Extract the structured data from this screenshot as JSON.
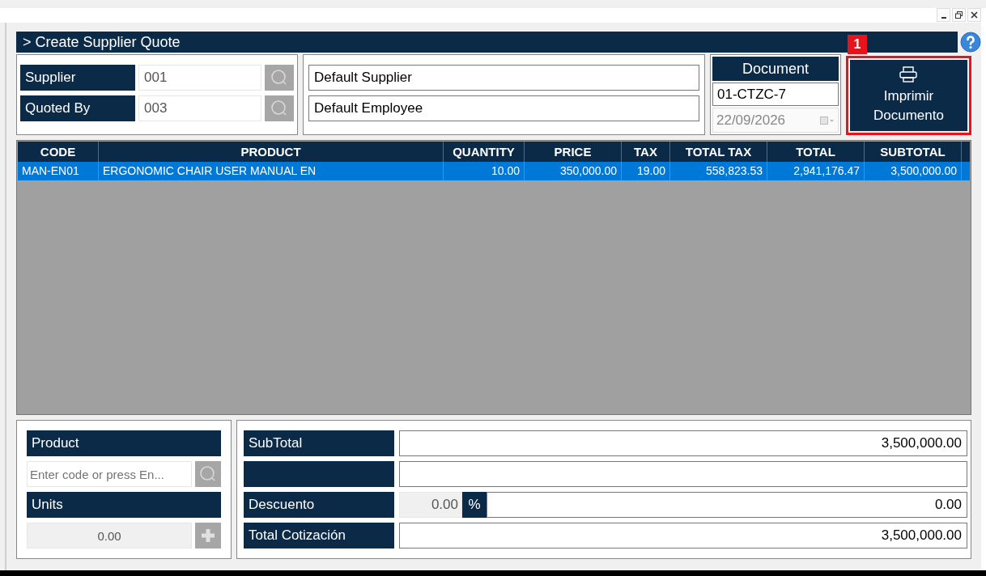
{
  "header": {
    "title": "> Create Supplier Quote"
  },
  "lookups": [
    {
      "label": "Supplier",
      "value": "001",
      "name": "Default Supplier"
    },
    {
      "label": "Quoted By",
      "value": "003",
      "name": "Default Employee"
    }
  ],
  "document": {
    "label": "Document",
    "number": "01-CTZC-7",
    "date": "22/09/2026",
    "date_disabled": true
  },
  "print_button": {
    "label": "Imprimir Documento"
  },
  "callout": {
    "label": "1"
  },
  "table": {
    "columns": [
      "CODE",
      "PRODUCT",
      "QUANTITY",
      "PRICE",
      "TAX",
      "TOTAL TAX",
      "TOTAL",
      "SUBTOTAL"
    ],
    "rows": [
      {
        "selected": true,
        "cells": [
          "MAN-EN01",
          "ERGONOMIC CHAIR USER MANUAL EN",
          "10.00",
          "350,000.00",
          "19.00",
          "558,823.53",
          "2,941,176.47",
          "3,500,000.00"
        ]
      }
    ]
  },
  "product_entry": {
    "label": "Product",
    "placeholder": "Enter code or press En...",
    "units_label": "Units",
    "units_value": "0.00"
  },
  "totals": [
    {
      "kind": "plain",
      "label": "SubTotal",
      "value": "3,500,000.00"
    },
    {
      "kind": "plain"
    },
    {
      "kind": "discount",
      "label": "Descuento",
      "percent_value": "0.00",
      "percent_sign": "%",
      "value": "0.00"
    },
    {
      "kind": "plain",
      "label": "Total Cotización",
      "value": "3,500,000.00"
    }
  ]
}
